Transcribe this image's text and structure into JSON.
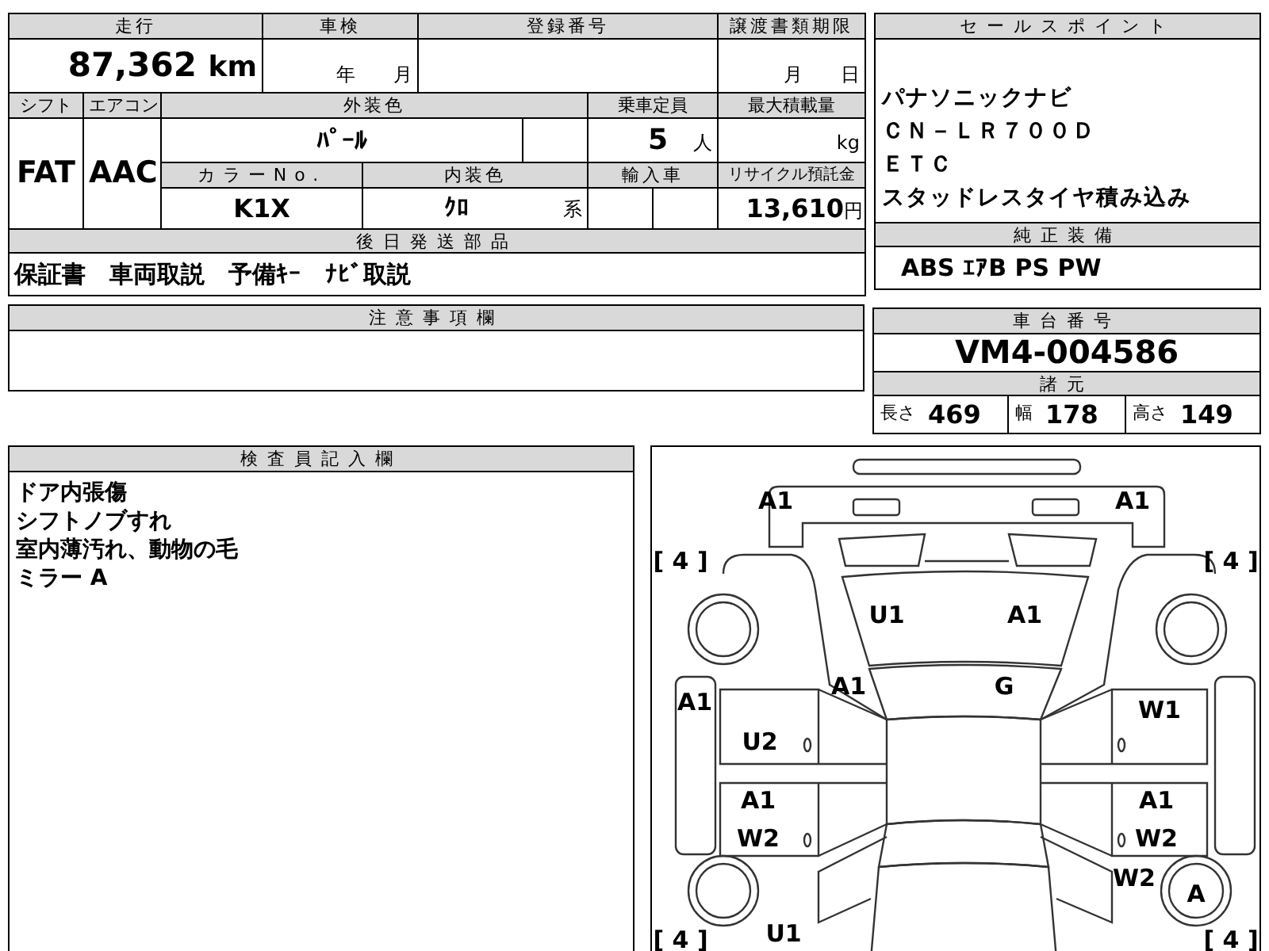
{
  "vehicle_table": {
    "mileage": {
      "label": "走行",
      "value": "87,362",
      "unit": "km"
    },
    "inspection": {
      "label": "車検",
      "year": "年",
      "month": "月"
    },
    "registration_number": {
      "label": "登録番号"
    },
    "transfer_deadline": {
      "label": "譲渡書類期限",
      "month": "月",
      "day": "日"
    },
    "shift": {
      "label": "シフト",
      "value": "FAT"
    },
    "aircon": {
      "label": "エアコン",
      "value": "AAC"
    },
    "exterior_color": {
      "label": "外装色",
      "value": "ﾊﾟｰﾙ"
    },
    "capacity": {
      "label": "乗車定員",
      "value": "5",
      "unit": "人"
    },
    "max_load": {
      "label": "最大積載量",
      "unit": "kg"
    },
    "color_no": {
      "label": "カラーNo.",
      "value": "K1X"
    },
    "interior_color": {
      "label": "内装色",
      "value": "ｸﾛ",
      "suffix": "系"
    },
    "imported": {
      "label": "輸入車"
    },
    "recycle_fee": {
      "label": "リサイクル預託金",
      "value": "13,610",
      "unit": "円"
    },
    "parts_to_send": {
      "label": "後日発送部品",
      "value": "保証書　車両取説　予備ｷｰ　ﾅﾋﾞ取説"
    }
  },
  "sales_points": {
    "label": "セールスポイント",
    "lines": [
      "パナソニックナビ",
      "ＣＮ－ＬＲ７００Ｄ",
      "ＥＴＣ",
      "スタッドレスタイヤ積み込み"
    ]
  },
  "factory_equipment": {
    "label": "純正装備",
    "value": "ABS ｴｱB PS PW"
  },
  "notes": {
    "label": "注意事項欄"
  },
  "chassis": {
    "label": "車台番号",
    "value": "VM4-004586"
  },
  "specs": {
    "label": "諸元",
    "items": [
      {
        "label": "長さ",
        "value": "469"
      },
      {
        "label": "幅",
        "value": "178"
      },
      {
        "label": "高さ",
        "value": "149"
      }
    ]
  },
  "inspector_notes": {
    "label": "検査員記入欄",
    "lines": [
      "ドア内張傷",
      "シフトノブすれ",
      "室内薄汚れ、動物の毛",
      "ミラー A"
    ]
  },
  "diagram": {
    "marks": {
      "bumper_front_left": [
        "A1"
      ],
      "bumper_front_right": [
        "A1"
      ],
      "tire_front_left": [
        "[ 4 ]"
      ],
      "tire_front_right": [
        "[ 4 ]"
      ],
      "hood_left": [
        "U1"
      ],
      "hood_right": [
        "A1"
      ],
      "sill_left": [
        "A1"
      ],
      "pillar_left": [
        "A1"
      ],
      "windshield": [
        "G"
      ],
      "door_front_right": [
        "W1"
      ],
      "door_front_left": [
        "U2"
      ],
      "door_rear_left": [
        "A1",
        "W2"
      ],
      "door_rear_right": [
        "A1",
        "W2"
      ],
      "quarter_right": [
        "W2"
      ],
      "wheel_rear_right": [
        "A"
      ],
      "quarter_left": [
        "U1"
      ],
      "tire_rear_left": [
        "[ 4 ]"
      ],
      "tire_rear_right": [
        "[ 4 ]"
      ]
    }
  }
}
